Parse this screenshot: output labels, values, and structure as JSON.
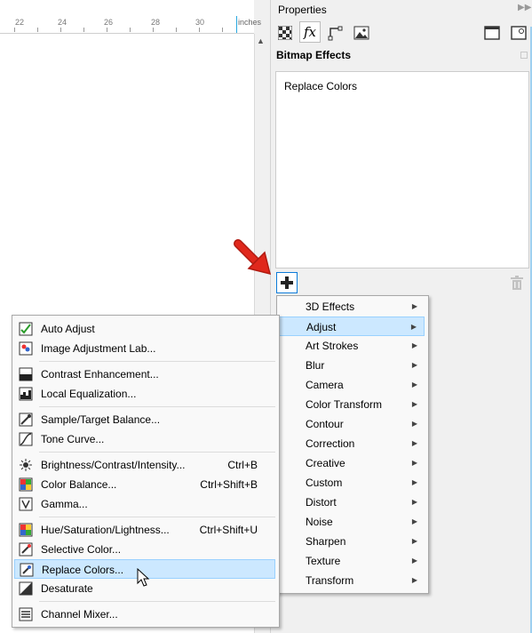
{
  "ruler": {
    "ticks": [
      "22",
      "24",
      "26",
      "28",
      "30"
    ],
    "units": "inches"
  },
  "panel": {
    "title": "Properties",
    "section_title": "Bitmap Effects",
    "effects": [
      "Replace Colors"
    ]
  },
  "submenu": {
    "items": [
      "3D Effects",
      "Adjust",
      "Art Strokes",
      "Blur",
      "Camera",
      "Color Transform",
      "Contour",
      "Correction",
      "Creative",
      "Custom",
      "Distort",
      "Noise",
      "Sharpen",
      "Texture",
      "Transform"
    ],
    "highlighted": "Adjust"
  },
  "adjust_menu": {
    "groups": [
      [
        {
          "label": "Auto Adjust",
          "shortcut": ""
        },
        {
          "label": "Image Adjustment Lab...",
          "shortcut": ""
        }
      ],
      [
        {
          "label": "Contrast Enhancement...",
          "shortcut": ""
        },
        {
          "label": "Local Equalization...",
          "shortcut": ""
        }
      ],
      [
        {
          "label": "Sample/Target Balance...",
          "shortcut": ""
        },
        {
          "label": "Tone Curve...",
          "shortcut": ""
        }
      ],
      [
        {
          "label": "Brightness/Contrast/Intensity...",
          "shortcut": "Ctrl+B"
        },
        {
          "label": "Color Balance...",
          "shortcut": "Ctrl+Shift+B"
        },
        {
          "label": "Gamma...",
          "shortcut": ""
        }
      ],
      [
        {
          "label": "Hue/Saturation/Lightness...",
          "shortcut": "Ctrl+Shift+U"
        },
        {
          "label": "Selective Color...",
          "shortcut": ""
        },
        {
          "label": "Replace Colors...",
          "shortcut": ""
        },
        {
          "label": "Desaturate",
          "shortcut": ""
        }
      ],
      [
        {
          "label": "Channel Mixer...",
          "shortcut": ""
        }
      ]
    ],
    "highlighted": "Replace Colors..."
  },
  "colors": {
    "highlight": "#cce8ff",
    "highlight_border": "#99d1ff",
    "accent": "#0c7bd9",
    "arrow": "#e0281c"
  }
}
